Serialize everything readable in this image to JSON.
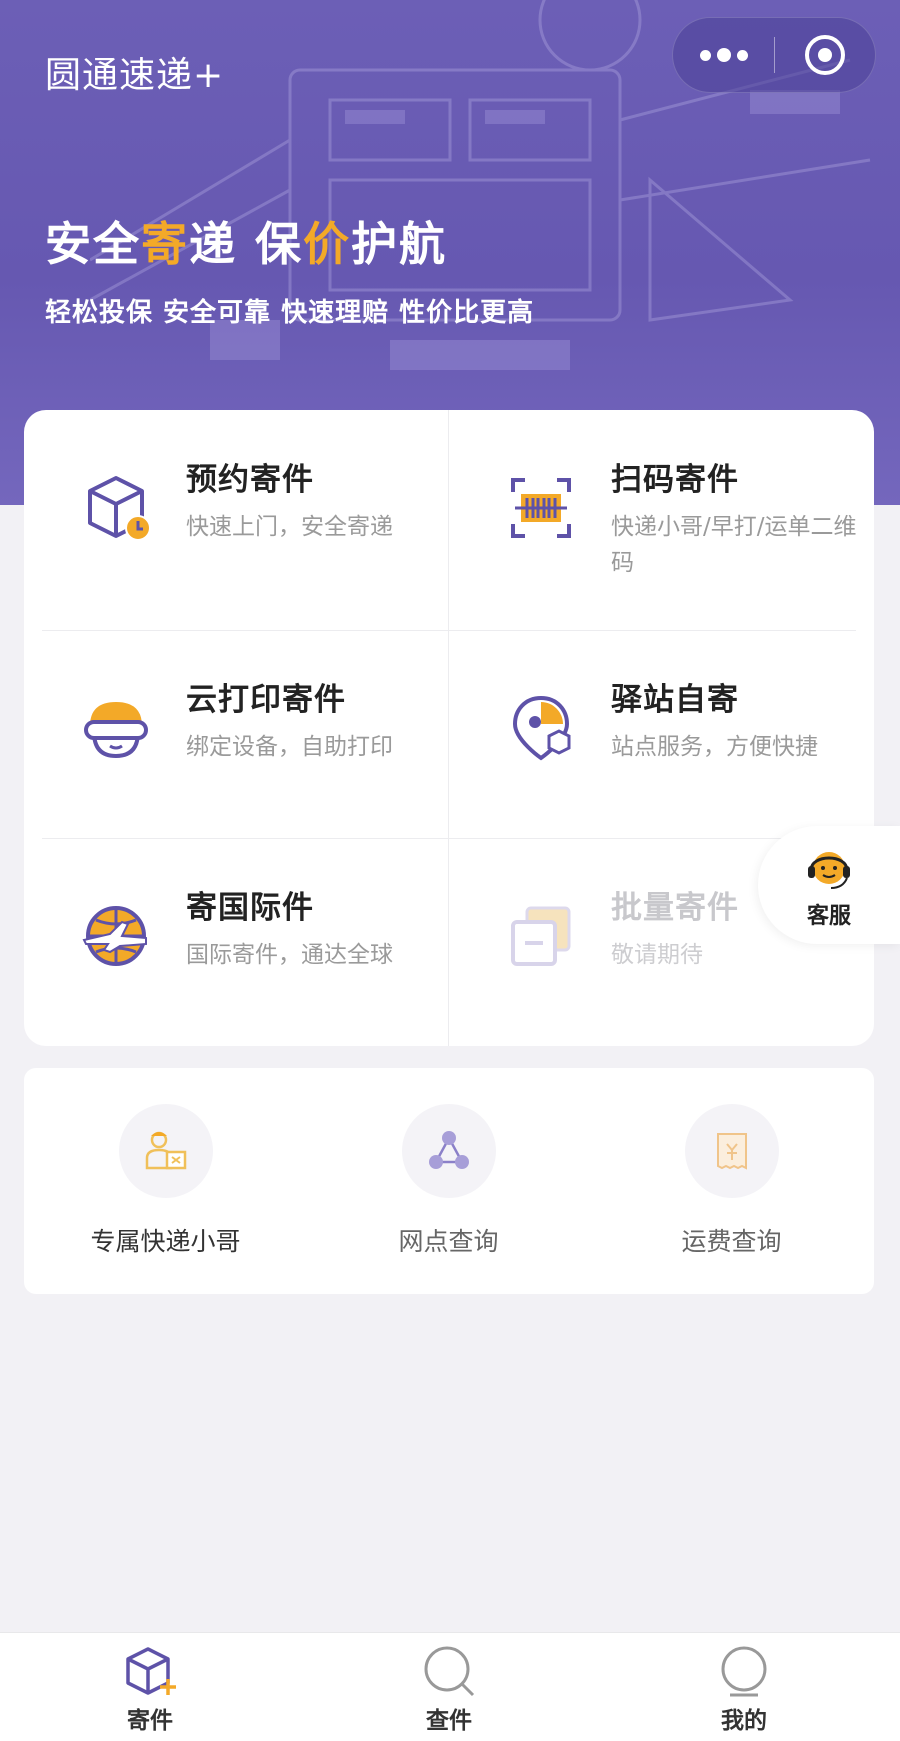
{
  "app": {
    "title": "圆通速递+"
  },
  "capsule": {
    "more_icon": "more-dots-icon",
    "close_icon": "target-icon"
  },
  "hero": {
    "slogan_parts": [
      "安全",
      "寄",
      "递 保",
      "价",
      "护航"
    ],
    "subtitle": "轻松投保 安全可靠 快速理赔 性价比更高",
    "accent_color": "#f3a928",
    "brand_color": "#6a5cb4"
  },
  "services": [
    {
      "title": "预约寄件",
      "desc": "快速上门，安全寄递",
      "icon": "package-clock-icon",
      "enabled": true
    },
    {
      "title": "扫码寄件",
      "desc": "快递小哥/早打/运单二维码",
      "icon": "scan-barcode-icon",
      "enabled": true
    },
    {
      "title": "云打印寄件",
      "desc": "绑定设备，自助打印",
      "icon": "cloud-print-icon",
      "enabled": true
    },
    {
      "title": "驿站自寄",
      "desc": "站点服务，方便快捷",
      "icon": "station-pin-icon",
      "enabled": true
    },
    {
      "title": "寄国际件",
      "desc": "国际寄件，通达全球",
      "icon": "globe-plane-icon",
      "enabled": true
    },
    {
      "title": "批量寄件",
      "desc": "敬请期待",
      "icon": "batch-docs-icon",
      "enabled": false
    }
  ],
  "tools": [
    {
      "label": "专属快递小哥",
      "icon": "courier-icon"
    },
    {
      "label": "网点查询",
      "icon": "network-nodes-icon"
    },
    {
      "label": "运费查询",
      "icon": "freight-stamp-icon"
    }
  ],
  "customer_service": {
    "label": "客服",
    "icon": "headset-agent-icon"
  },
  "tabbar": [
    {
      "label": "寄件",
      "icon": "send-box-icon",
      "active": true
    },
    {
      "label": "查件",
      "icon": "search-icon",
      "active": false
    },
    {
      "label": "我的",
      "icon": "profile-icon",
      "active": false
    }
  ]
}
